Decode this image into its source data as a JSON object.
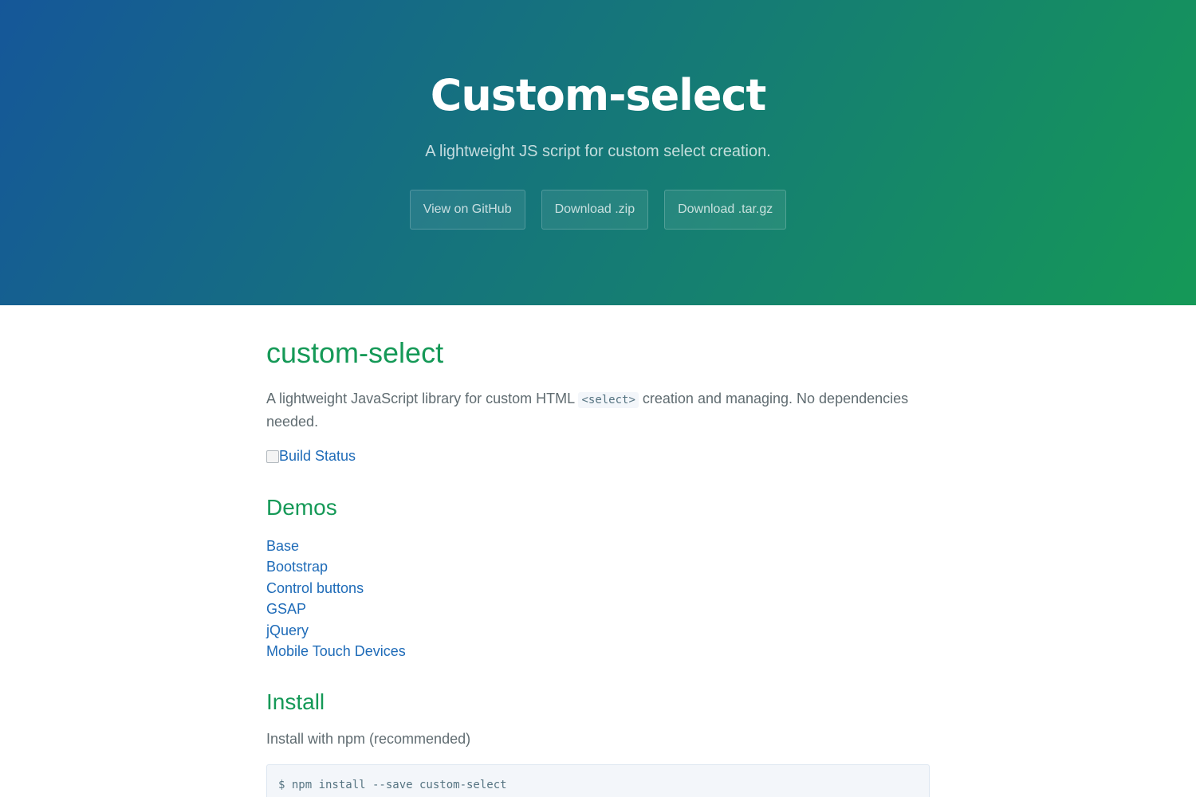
{
  "header": {
    "title": "Custom-select",
    "tagline": "A lightweight JS script for custom select creation.",
    "buttons": [
      {
        "label": "View on GitHub"
      },
      {
        "label": "Download .zip"
      },
      {
        "label": "Download .tar.gz"
      }
    ]
  },
  "main": {
    "title": "custom-select",
    "intro_before": "A lightweight JavaScript library for custom HTML ",
    "intro_code": "<select>",
    "intro_after": " creation and managing. No dependencies needed.",
    "build_status_alt": "Build Status",
    "demos": {
      "heading": "Demos",
      "items": [
        {
          "label": "Base"
        },
        {
          "label": "Bootstrap"
        },
        {
          "label": "Control buttons"
        },
        {
          "label": "GSAP"
        },
        {
          "label": "jQuery"
        },
        {
          "label": "Mobile Touch Devices"
        }
      ]
    },
    "install": {
      "heading": "Install",
      "text": "Install with npm (recommended)",
      "command": "$ npm install --save custom-select"
    }
  },
  "colors": {
    "gradient_start": "#155799",
    "gradient_end": "#159957",
    "heading_green": "#159957",
    "link_blue": "#1e6bb8",
    "body_text": "#606c71"
  }
}
